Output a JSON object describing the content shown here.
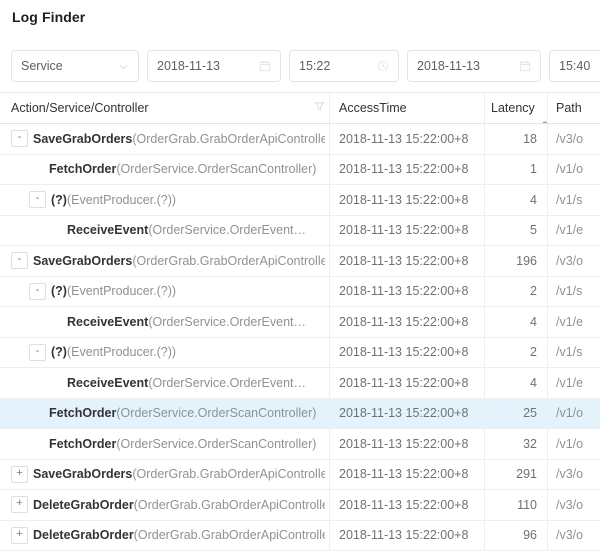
{
  "page": {
    "title": "Log Finder"
  },
  "toolbar": {
    "service_select": {
      "value": "Service",
      "placeholder": "Service",
      "icon": "chevron-down-icon"
    },
    "start_date": {
      "value": "2018-11-13",
      "icon": "calendar-icon"
    },
    "start_time": {
      "value": "15:22",
      "icon": "clock-icon"
    },
    "end_date": {
      "value": "2018-11-13",
      "icon": "calendar-icon"
    },
    "end_time": {
      "value": "15:40",
      "icon": "clock-icon"
    }
  },
  "table": {
    "columns": [
      {
        "key": "action",
        "label": "Action/Service/Controller",
        "filter_icon": "filter-funnel-icon"
      },
      {
        "key": "time",
        "label": "AccessTime"
      },
      {
        "key": "latency",
        "label": "Latency",
        "filter_icon": "filter-funnel-icon",
        "sorted": true
      },
      {
        "key": "path",
        "label": "Path"
      }
    ],
    "rows": [
      {
        "toggle": "-",
        "indent": 0,
        "name": "SaveGrabOrders",
        "detail": "(OrderGrab.GrabOrderApiController)",
        "time": "2018-11-13 15:22:00+8",
        "latency": "18",
        "path": "/v3/o",
        "selected": false
      },
      {
        "toggle": "",
        "indent": 1,
        "name": "FetchOrder",
        "detail": "(OrderService.OrderScanController)",
        "time": "2018-11-13 15:22:00+8",
        "latency": "1",
        "path": "/v1/o",
        "selected": false
      },
      {
        "toggle": "-",
        "indent": 1,
        "name": "(?)",
        "detail": "(EventProducer.(?))",
        "time": "2018-11-13 15:22:00+8",
        "latency": "4",
        "path": "/v1/s",
        "selected": false
      },
      {
        "toggle": "",
        "indent": 2,
        "name": "ReceiveEvent",
        "detail": "(OrderService.OrderEvent…",
        "time": "2018-11-13 15:22:00+8",
        "latency": "5",
        "path": "/v1/e",
        "selected": false
      },
      {
        "toggle": "-",
        "indent": 0,
        "name": "SaveGrabOrders",
        "detail": "(OrderGrab.GrabOrderApiController)",
        "time": "2018-11-13 15:22:00+8",
        "latency": "196",
        "path": "/v3/o",
        "selected": false
      },
      {
        "toggle": "-",
        "indent": 1,
        "name": "(?)",
        "detail": "(EventProducer.(?))",
        "time": "2018-11-13 15:22:00+8",
        "latency": "2",
        "path": "/v1/s",
        "selected": false
      },
      {
        "toggle": "",
        "indent": 2,
        "name": "ReceiveEvent",
        "detail": "(OrderService.OrderEvent…",
        "time": "2018-11-13 15:22:00+8",
        "latency": "4",
        "path": "/v1/e",
        "selected": false
      },
      {
        "toggle": "-",
        "indent": 1,
        "name": "(?)",
        "detail": "(EventProducer.(?))",
        "time": "2018-11-13 15:22:00+8",
        "latency": "2",
        "path": "/v1/s",
        "selected": false
      },
      {
        "toggle": "",
        "indent": 2,
        "name": "ReceiveEvent",
        "detail": "(OrderService.OrderEvent…",
        "time": "2018-11-13 15:22:00+8",
        "latency": "4",
        "path": "/v1/e",
        "selected": false
      },
      {
        "toggle": "",
        "indent": 1,
        "name": "FetchOrder",
        "detail": "(OrderService.OrderScanController)",
        "time": "2018-11-13 15:22:00+8",
        "latency": "25",
        "path": "/v1/o",
        "selected": true
      },
      {
        "toggle": "",
        "indent": 1,
        "name": "FetchOrder",
        "detail": "(OrderService.OrderScanController)",
        "time": "2018-11-13 15:22:00+8",
        "latency": "32",
        "path": "/v1/o",
        "selected": false
      },
      {
        "toggle": "+",
        "indent": 0,
        "name": "SaveGrabOrders",
        "detail": "(OrderGrab.GrabOrderApiController)",
        "time": "2018-11-13 15:22:00+8",
        "latency": "291",
        "path": "/v3/o",
        "selected": false
      },
      {
        "toggle": "+",
        "indent": 0,
        "name": "DeleteGrabOrder",
        "detail": "(OrderGrab.GrabOrderApiController)",
        "time": "2018-11-13 15:22:00+8",
        "latency": "110",
        "path": "/v3/o",
        "selected": false
      },
      {
        "toggle": "+",
        "indent": 0,
        "name": "DeleteGrabOrder",
        "detail": "(OrderGrab.GrabOrderApiController)",
        "time": "2018-11-13 15:22:00+8",
        "latency": "96",
        "path": "/v3/o",
        "selected": false
      }
    ]
  },
  "colors": {
    "selected_row": "#e4f3fb",
    "border": "#eceef1",
    "text_primary": "#30343a",
    "text_secondary": "#8d9299"
  }
}
